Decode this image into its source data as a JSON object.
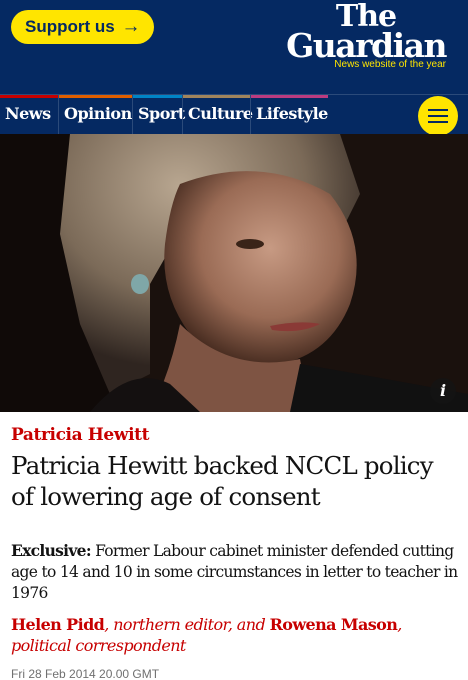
{
  "header": {
    "support_label": "Support us",
    "support_arrow": "→",
    "logo_the": "The",
    "logo_guardian": "Guardian",
    "tagline": "News website of the year"
  },
  "nav": {
    "items": [
      {
        "label": "News",
        "color": "#c70000"
      },
      {
        "label": "Opinion",
        "color": "#e05e00"
      },
      {
        "label": "Sport",
        "color": "#0084c6"
      },
      {
        "label": "Culture",
        "color": "#a1845c"
      },
      {
        "label": "Lifestyle",
        "color": "#bb3b80"
      }
    ],
    "menu_icon": "hamburger-menu-icon"
  },
  "hero": {
    "info_label": "i"
  },
  "article": {
    "kicker": "Patricia Hewitt",
    "headline": "Patricia Hewitt backed NCCL policy of lowering age of consent",
    "standfirst_prefix": "Exclusive:",
    "standfirst": "Former Labour cabinet minister defended cutting age to 14 and 10 in some circumstances in letter to teacher in 1976",
    "byline": {
      "author1": "Helen Pidd",
      "role1": ", northern editor, and ",
      "author2": "Rowena Mason",
      "role2": ", political correspondent"
    },
    "date": "Fri 28 Feb 2014 20.00 GMT"
  },
  "colors": {
    "brand": "#052962",
    "accent": "#ffe500",
    "news": "#c70000"
  }
}
